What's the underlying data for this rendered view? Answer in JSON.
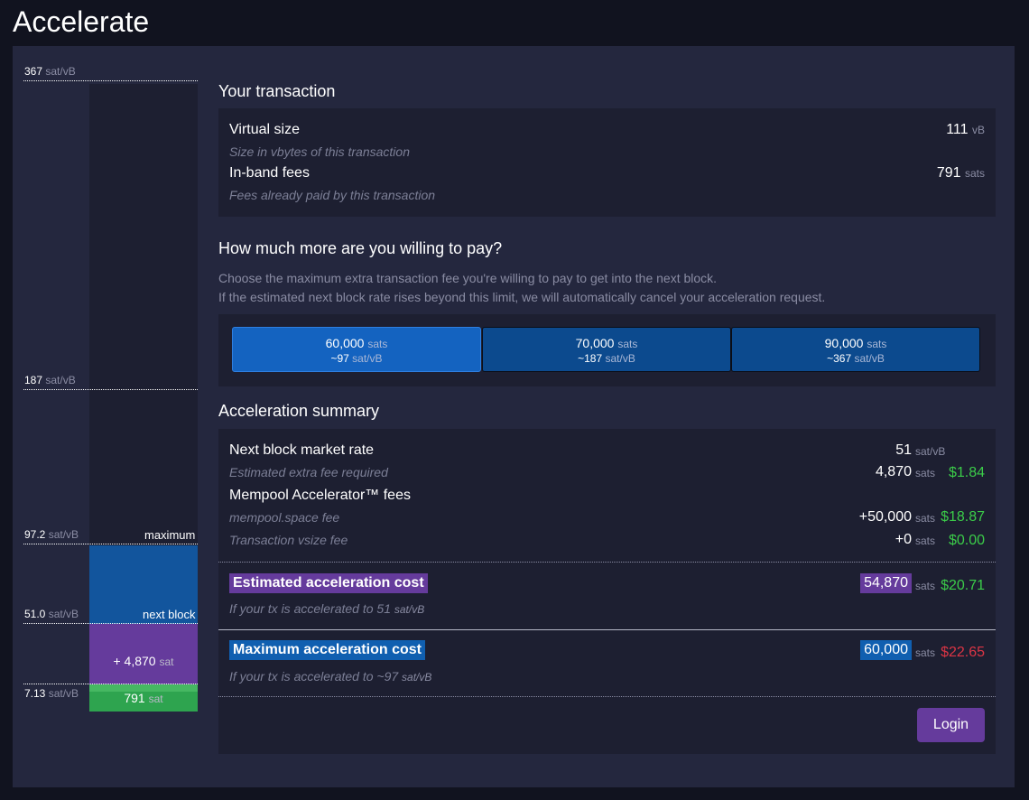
{
  "page": {
    "title": "Accelerate"
  },
  "chart": {
    "rates": [
      {
        "value": "367",
        "unit": "sat/vB"
      },
      {
        "value": "187",
        "unit": "sat/vB"
      },
      {
        "value": "97.2",
        "unit": "sat/vB",
        "label": "maximum"
      },
      {
        "value": "51.0",
        "unit": "sat/vB",
        "label": "next block"
      },
      {
        "value": "7.13",
        "unit": "sat/vB"
      }
    ],
    "extra_label": "+ 4,870",
    "extra_unit": "sat",
    "fee_label": "791",
    "fee_unit": "sat",
    "colors": {
      "maximum": "#105fb0",
      "extra": "#653b9c",
      "fee": "#2ea44f"
    }
  },
  "transaction": {
    "heading": "Your transaction",
    "vsize_label": "Virtual size",
    "vsize_sub": "Size in vbytes of this transaction",
    "vsize_value": "111",
    "vsize_unit": "vB",
    "fees_label": "In-band fees",
    "fees_sub": "Fees already paid by this transaction",
    "fees_value": "791",
    "fees_unit": "sats"
  },
  "willing": {
    "heading": "How much more are you willing to pay?",
    "desc_line1": "Choose the maximum extra transaction fee you're willing to pay to get into the next block.",
    "desc_line2": "If the estimated next block rate rises beyond this limit, we will automatically cancel your acceleration request.",
    "options": [
      {
        "amount": "60,000",
        "unit": "sats",
        "rate": "~97",
        "rate_unit": "sat/vB",
        "selected": true
      },
      {
        "amount": "70,000",
        "unit": "sats",
        "rate": "~187",
        "rate_unit": "sat/vB",
        "selected": false
      },
      {
        "amount": "90,000",
        "unit": "sats",
        "rate": "~367",
        "rate_unit": "sat/vB",
        "selected": false
      }
    ]
  },
  "summary": {
    "heading": "Acceleration summary",
    "market_label": "Next block market rate",
    "market_value": "51",
    "market_unit": "sat/vB",
    "extra_label": "Estimated extra fee required",
    "extra_value": "4,870",
    "extra_unit": "sats",
    "extra_usd": "$1.84",
    "fees_label": "Mempool Accelerator™ fees",
    "mempool_label": "mempool.space fee",
    "mempool_value": "+50,000",
    "mempool_unit": "sats",
    "mempool_usd": "$18.87",
    "vsize_label": "Transaction vsize fee",
    "vsize_value": "+0",
    "vsize_unit": "sats",
    "vsize_usd": "$0.00",
    "est_label": "Estimated acceleration cost",
    "est_sub": "If your tx is accelerated to 51",
    "est_sub_unit": "sat/vB",
    "est_value": "54,870",
    "est_unit": "sats",
    "est_usd": "$20.71",
    "max_label": "Maximum acceleration cost",
    "max_sub": "If your tx is accelerated to ~97",
    "max_sub_unit": "sat/vB",
    "max_value": "60,000",
    "max_unit": "sats",
    "max_usd": "$22.65",
    "login_label": "Login"
  }
}
